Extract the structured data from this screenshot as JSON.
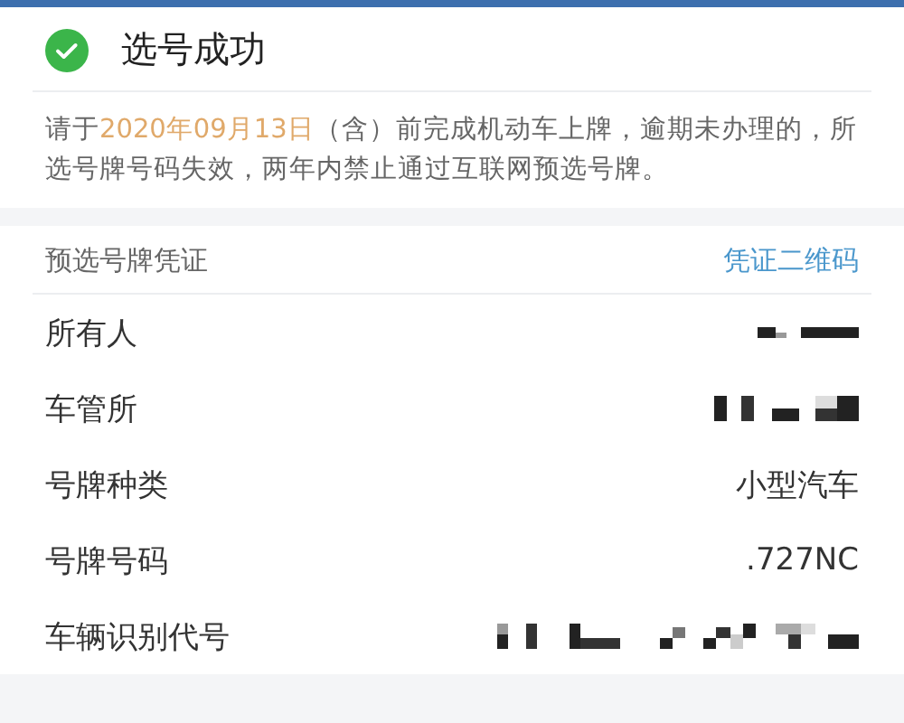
{
  "header": {
    "title": "选号成功"
  },
  "notice": [
    {
      "text": "请于",
      "highlight": false
    },
    {
      "text": "2020年09月13日",
      "highlight": true
    },
    {
      "text": "（含）前完成机动车上牌，逾期未办理的，所选号牌号码失效，两年内禁止通过互联网预选号牌。",
      "highlight": false
    }
  ],
  "voucher": {
    "title": "预选号牌凭证",
    "link": "凭证二维码"
  },
  "rows": [
    {
      "label": "所有人",
      "kind": "redacted"
    },
    {
      "label": "车管所",
      "kind": "redacted"
    },
    {
      "label": "号牌种类",
      "kind": "text",
      "value": "小型汽车"
    },
    {
      "label": "号牌号码",
      "kind": "text",
      "value": ".727NC"
    },
    {
      "label": "车辆识别代号",
      "kind": "redacted"
    }
  ]
}
